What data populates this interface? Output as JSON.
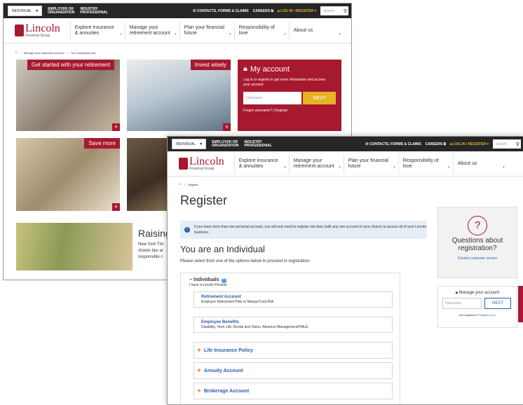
{
  "topbar": {
    "individual": "INDIVIDUAL",
    "employer": [
      "EMPLOYER OR",
      "ORGANIZATION"
    ],
    "industry": [
      "INDUSTRY",
      "PROFESSIONAL"
    ],
    "contacts": "CONTACTS, FORMS & CLAIMS",
    "careers": "CAREERS",
    "login": "LOG IN / REGISTER",
    "search_placeholder": "Search"
  },
  "logo": {
    "line1": "Lincoln",
    "line2": "Financial Group"
  },
  "nav": [
    {
      "label": "Explore insurance & annuities"
    },
    {
      "label": "Manage your retirement account"
    },
    {
      "label": "Plan your financial future"
    },
    {
      "label": "Responsibility of love"
    },
    {
      "label": "About us"
    }
  ],
  "back": {
    "breadcrumb": [
      "Manage your retirement account",
      "Your workplace plan"
    ],
    "tiles": [
      {
        "label": "Get started with your retirement"
      },
      {
        "label": "Invest wisely"
      },
      {
        "label": "Save more"
      }
    ],
    "account": {
      "title": "My account",
      "desc": "Log in or register to get more information and access your account",
      "username_placeholder": "Username",
      "next": "NEXT",
      "forgot": "Forgot username?",
      "register": "Register"
    },
    "article": {
      "title": "Raising",
      "lines": [
        "New York Tim",
        "shares tips ar",
        "responsible c"
      ]
    }
  },
  "front": {
    "breadcrumb": "Register",
    "title": "Register",
    "info": "If you have more than one personal account, you will only need to register one time (with any one account of your choice) to access all of your Lincoln business.",
    "heading": "You are an Individual",
    "instruction": "Please select from one of the options below to proceed to registration.",
    "individuals": {
      "label": "Individuals",
      "sub": "I have a Lincoln Product"
    },
    "options": [
      {
        "title": "Retirement Account",
        "sub": "Employer Retirement Plan or Mutual Fund IRA"
      },
      {
        "title": "Employee Benefits",
        "sub": "Disability, Term Life, Dental and Vision, Absence Management/FMLA."
      }
    ],
    "collapsed": [
      "Life Insurance Policy",
      "Annuity Account",
      "Brokerage Account"
    ],
    "questions": {
      "title": "Questions about registration?",
      "link": "Contact customer service"
    },
    "manage": {
      "title": "Manage your account",
      "username_placeholder": "Username",
      "next": "NEXT",
      "not_registered": "Not registered?",
      "register_now": "Register now."
    }
  }
}
